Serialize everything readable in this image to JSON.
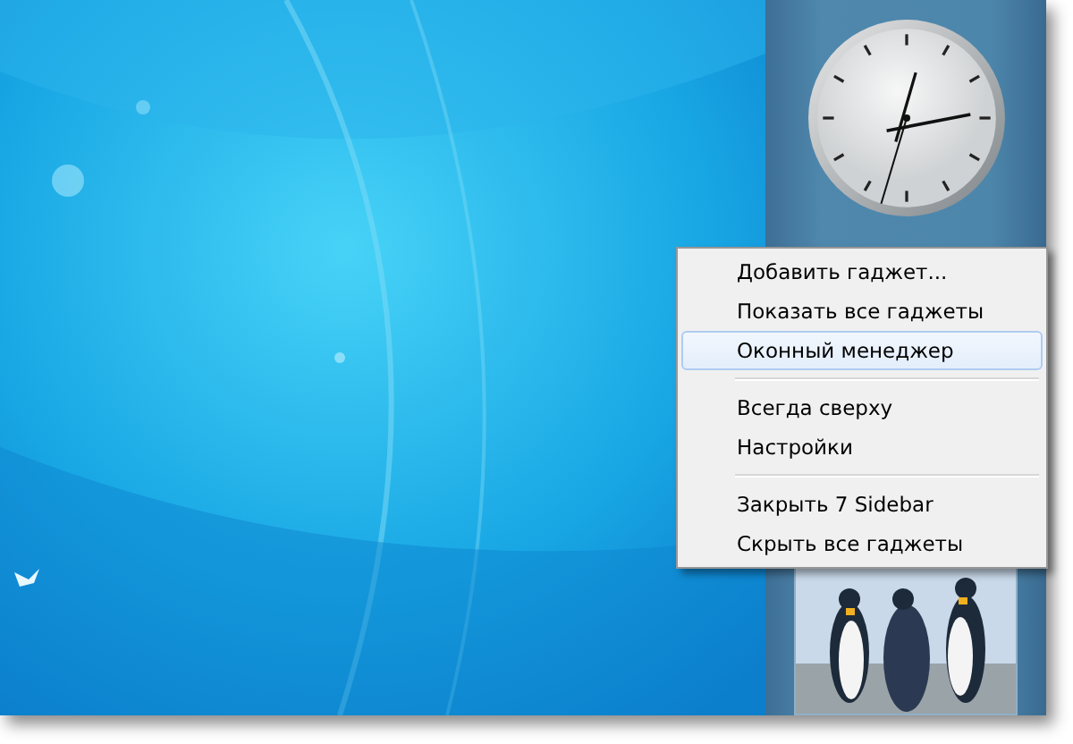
{
  "sidebar": {
    "gadgets": [
      {
        "kind": "clock"
      },
      {
        "kind": "slideshow"
      }
    ]
  },
  "context_menu": {
    "groups": [
      {
        "items": [
          {
            "label": "Добавить гаджет...",
            "selected": false
          },
          {
            "label": "Показать все гаджеты",
            "selected": false
          },
          {
            "label": "Оконный менеджер",
            "selected": true
          }
        ]
      },
      {
        "items": [
          {
            "label": "Всегда сверху",
            "selected": false
          },
          {
            "label": "Настройки",
            "selected": false
          }
        ]
      },
      {
        "items": [
          {
            "label": "Закрыть 7 Sidebar",
            "selected": false
          },
          {
            "label": "Скрыть все гаджеты",
            "selected": false
          }
        ]
      }
    ]
  }
}
